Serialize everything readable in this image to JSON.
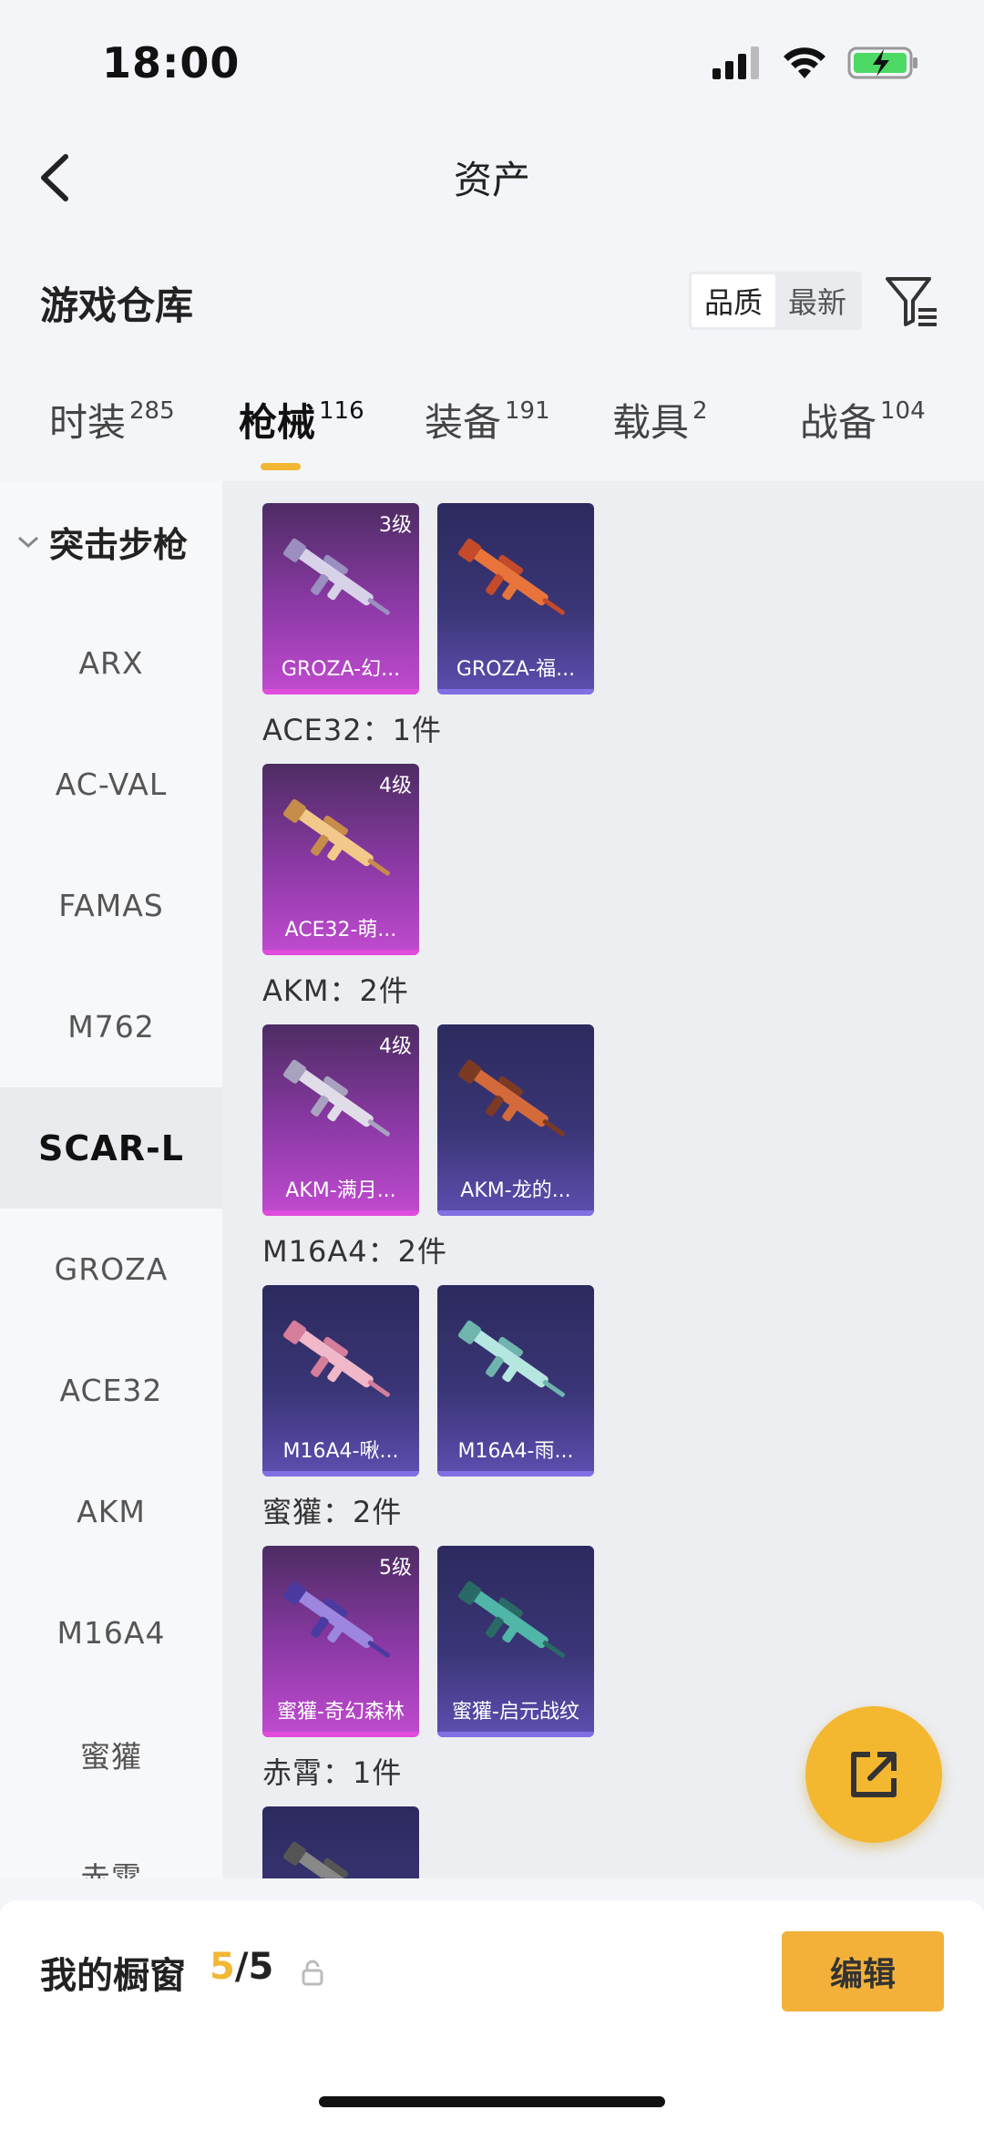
{
  "status": {
    "time": "18:00"
  },
  "header": {
    "title": "资产"
  },
  "section": {
    "title": "游戏仓库",
    "sort": [
      "品质",
      "最新"
    ]
  },
  "tabs": [
    {
      "label": "时装",
      "count": "285"
    },
    {
      "label": "枪械",
      "count": "116"
    },
    {
      "label": "装备",
      "count": "191"
    },
    {
      "label": "载具",
      "count": "2"
    },
    {
      "label": "战备",
      "count": "104"
    }
  ],
  "sidebar": {
    "group": "突击步枪",
    "items": [
      "ARX",
      "AC-VAL",
      "FAMAS",
      "M762",
      "SCAR-L",
      "GROZA",
      "ACE32",
      "AKM",
      "M16A4",
      "蜜獾",
      "赤霄"
    ]
  },
  "groups": [
    {
      "label": "",
      "cards": [
        {
          "name": "GROZA-幻...",
          "level": "3级",
          "color": "pink",
          "icon": "rifle-skin-icon"
        },
        {
          "name": "GROZA-福...",
          "level": "",
          "color": "blue",
          "icon": "rifle-skin-icon"
        }
      ]
    },
    {
      "label": "ACE32：1件",
      "cards": [
        {
          "name": "ACE32-萌...",
          "level": "4级",
          "color": "pink",
          "icon": "rifle-skin-icon"
        }
      ]
    },
    {
      "label": "AKM：2件",
      "cards": [
        {
          "name": "AKM-满月...",
          "level": "4级",
          "color": "pink",
          "icon": "rifle-skin-icon"
        },
        {
          "name": "AKM-龙的...",
          "level": "",
          "color": "blue",
          "icon": "rifle-skin-icon"
        }
      ]
    },
    {
      "label": "M16A4：2件",
      "cards": [
        {
          "name": "M16A4-啾...",
          "level": "",
          "color": "blue",
          "icon": "rifle-skin-icon"
        },
        {
          "name": "M16A4-雨...",
          "level": "",
          "color": "blue",
          "icon": "rifle-skin-icon"
        }
      ]
    },
    {
      "label": "蜜獾：2件",
      "cards": [
        {
          "name": "蜜獾-奇幻森林",
          "level": "5级",
          "color": "pink",
          "icon": "rifle-skin-icon"
        },
        {
          "name": "蜜獾-启元战纹",
          "level": "",
          "color": "blue",
          "icon": "rifle-skin-icon"
        }
      ]
    },
    {
      "label": "赤霄：1件",
      "cards": [
        {
          "name": "",
          "level": "",
          "color": "blue",
          "icon": "rifle-skin-icon"
        }
      ]
    }
  ],
  "bottom": {
    "label": "我的橱窗",
    "used": "5",
    "total": "/5",
    "edit": "编辑"
  },
  "colors": {
    "accent": "#f2b733",
    "rare_pink": "#c14bd0",
    "rare_blue": "#5d4fb1"
  }
}
